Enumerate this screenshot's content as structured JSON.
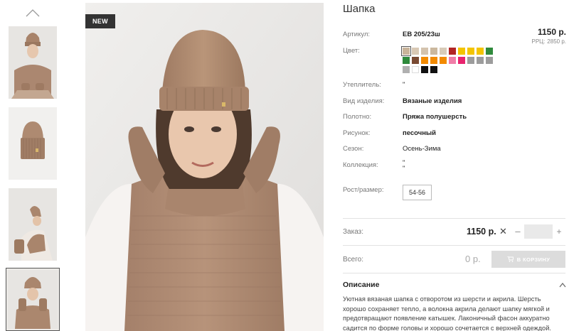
{
  "badge": "NEW",
  "product": {
    "title": "Шапка",
    "price": "1150 р.",
    "rrc_label": "РРЦ:",
    "rrc_value": "2850 р."
  },
  "attributes": {
    "article": {
      "label": "Артикул:",
      "value": "ЕВ 205/23ш"
    },
    "color": {
      "label": "Цвет:"
    },
    "insulation": {
      "label": "Утеплитель:",
      "value": "\""
    },
    "type": {
      "label": "Вид изделия:",
      "value": "Вязаные изделия"
    },
    "fabric": {
      "label": "Полотно:",
      "value": "Пряжа полушерсть"
    },
    "pattern": {
      "label": "Рисунок:",
      "value": "песочный"
    },
    "season": {
      "label": "Сезон:",
      "value": "Осень-Зима"
    },
    "collection": {
      "label": "Коллекция:",
      "value": "\"",
      "value2": "\""
    },
    "size": {
      "label": "Рост/размер:",
      "value": "54-56"
    }
  },
  "swatches": [
    "#c9b49a",
    "#d9c9b5",
    "#d4c3ae",
    "#cbb89e",
    "#d8cbb8",
    "#b22525",
    "#f3c400",
    "#f3c400",
    "#f3c400",
    "#2f8a3c",
    "#2f8a3c",
    "#7a4a33",
    "#f28a00",
    "#f28a00",
    "#f28a00",
    "#f07ea8",
    "#e8246e",
    "#9c9c9c",
    "#9c9c9c",
    "#9c9c9c",
    "#b0b0b0",
    "#ffffff",
    "#111111",
    "#111111"
  ],
  "order": {
    "label": "Заказ:",
    "price": "1150 р.",
    "x": "✕",
    "minus": "–",
    "plus": "+",
    "qty": ""
  },
  "total": {
    "label": "Всего:",
    "value": "0 р.",
    "cart_button": "В КОРЗИНУ"
  },
  "description": {
    "title": "Описание",
    "text": "Уютная вязаная шапка с отворотом из шерсти и акрила. Шерсть хорошо сохраняет тепло, а волокна акрила делают шапку мягкой и предотвращают появление катышек. Лаконичный фасон аккуратно садится по форме головы и хорошо сочетается с верхней одеждой."
  },
  "colors": {
    "camel": "#b08b6e",
    "skin": "#e8c9b0",
    "badge_bg": "#333333",
    "cart_button_bg": "#dcdcdc"
  }
}
